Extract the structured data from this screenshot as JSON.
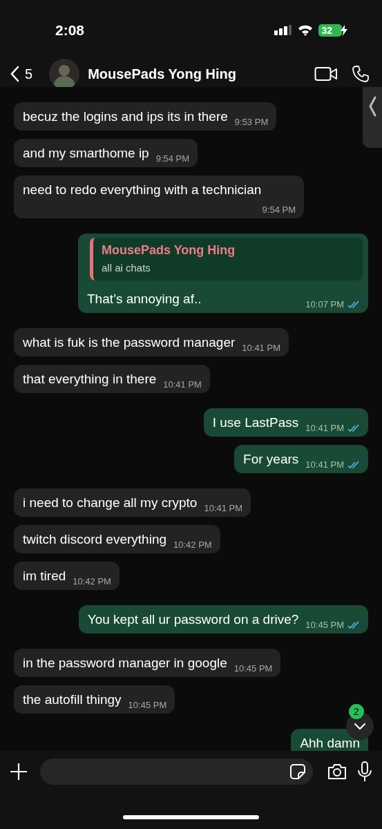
{
  "status_bar": {
    "time": "2:08",
    "battery": "32",
    "charging": true
  },
  "header": {
    "back_count": "5",
    "contact_name": "MousePads Yong Hing"
  },
  "messages": [
    {
      "kind": "in",
      "text": "becuz the logins and ips its in there",
      "time": "9:53 PM"
    },
    {
      "kind": "in",
      "text": "and my smarthome ip",
      "time": "9:54 PM"
    },
    {
      "kind": "in",
      "text": "need to redo everything with a technician",
      "time": "9:54 PM"
    },
    {
      "kind": "out",
      "quote": {
        "author": "MousePads Yong Hing",
        "text": "all ai chats"
      },
      "text": "That’s annoying af..",
      "time": "10:07 PM",
      "read": true
    },
    {
      "kind": "in",
      "text": "what is fuk is the password manager",
      "time": "10:41 PM"
    },
    {
      "kind": "in",
      "text": "that everything in there",
      "time": "10:41 PM"
    },
    {
      "kind": "out",
      "text": "I use LastPass",
      "time": "10:41 PM",
      "read": true
    },
    {
      "kind": "out",
      "text": "For years",
      "time": "10:41 PM",
      "read": true
    },
    {
      "kind": "in",
      "text": "i need to change all my crypto",
      "time": "10:41 PM"
    },
    {
      "kind": "in",
      "text": "twitch discord everything",
      "time": "10:42 PM"
    },
    {
      "kind": "in",
      "text": "im tired",
      "time": "10:42 PM"
    },
    {
      "kind": "out",
      "text": "You kept all ur password on a drive?",
      "time": "10:45 PM",
      "read": true
    },
    {
      "kind": "in",
      "text": "in the password manager in google",
      "time": "10:45 PM"
    },
    {
      "kind": "in",
      "text": "the autofill thingy",
      "time": "10:45 PM"
    },
    {
      "kind": "out",
      "text": "Ahh damn"
    }
  ],
  "scroll_down": {
    "unread_count": "2"
  }
}
